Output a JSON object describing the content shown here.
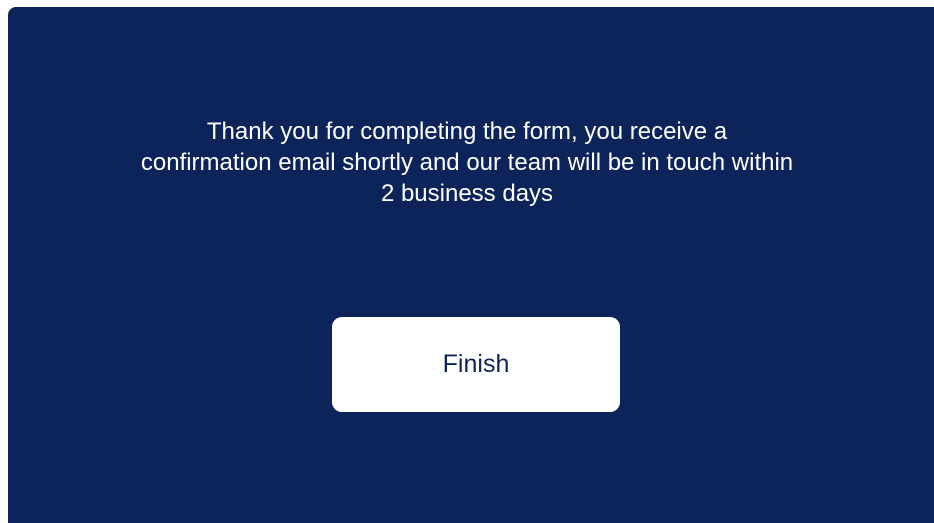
{
  "confirmation": {
    "message": "Thank you for completing the form, you receive a confirmation email shortly and our team will be in touch within 2 business days",
    "finish_label": "Finish"
  },
  "colors": {
    "panel_background": "#0c2459",
    "text_on_panel": "#ffffff",
    "button_background": "#ffffff",
    "button_text": "#0c2459"
  }
}
